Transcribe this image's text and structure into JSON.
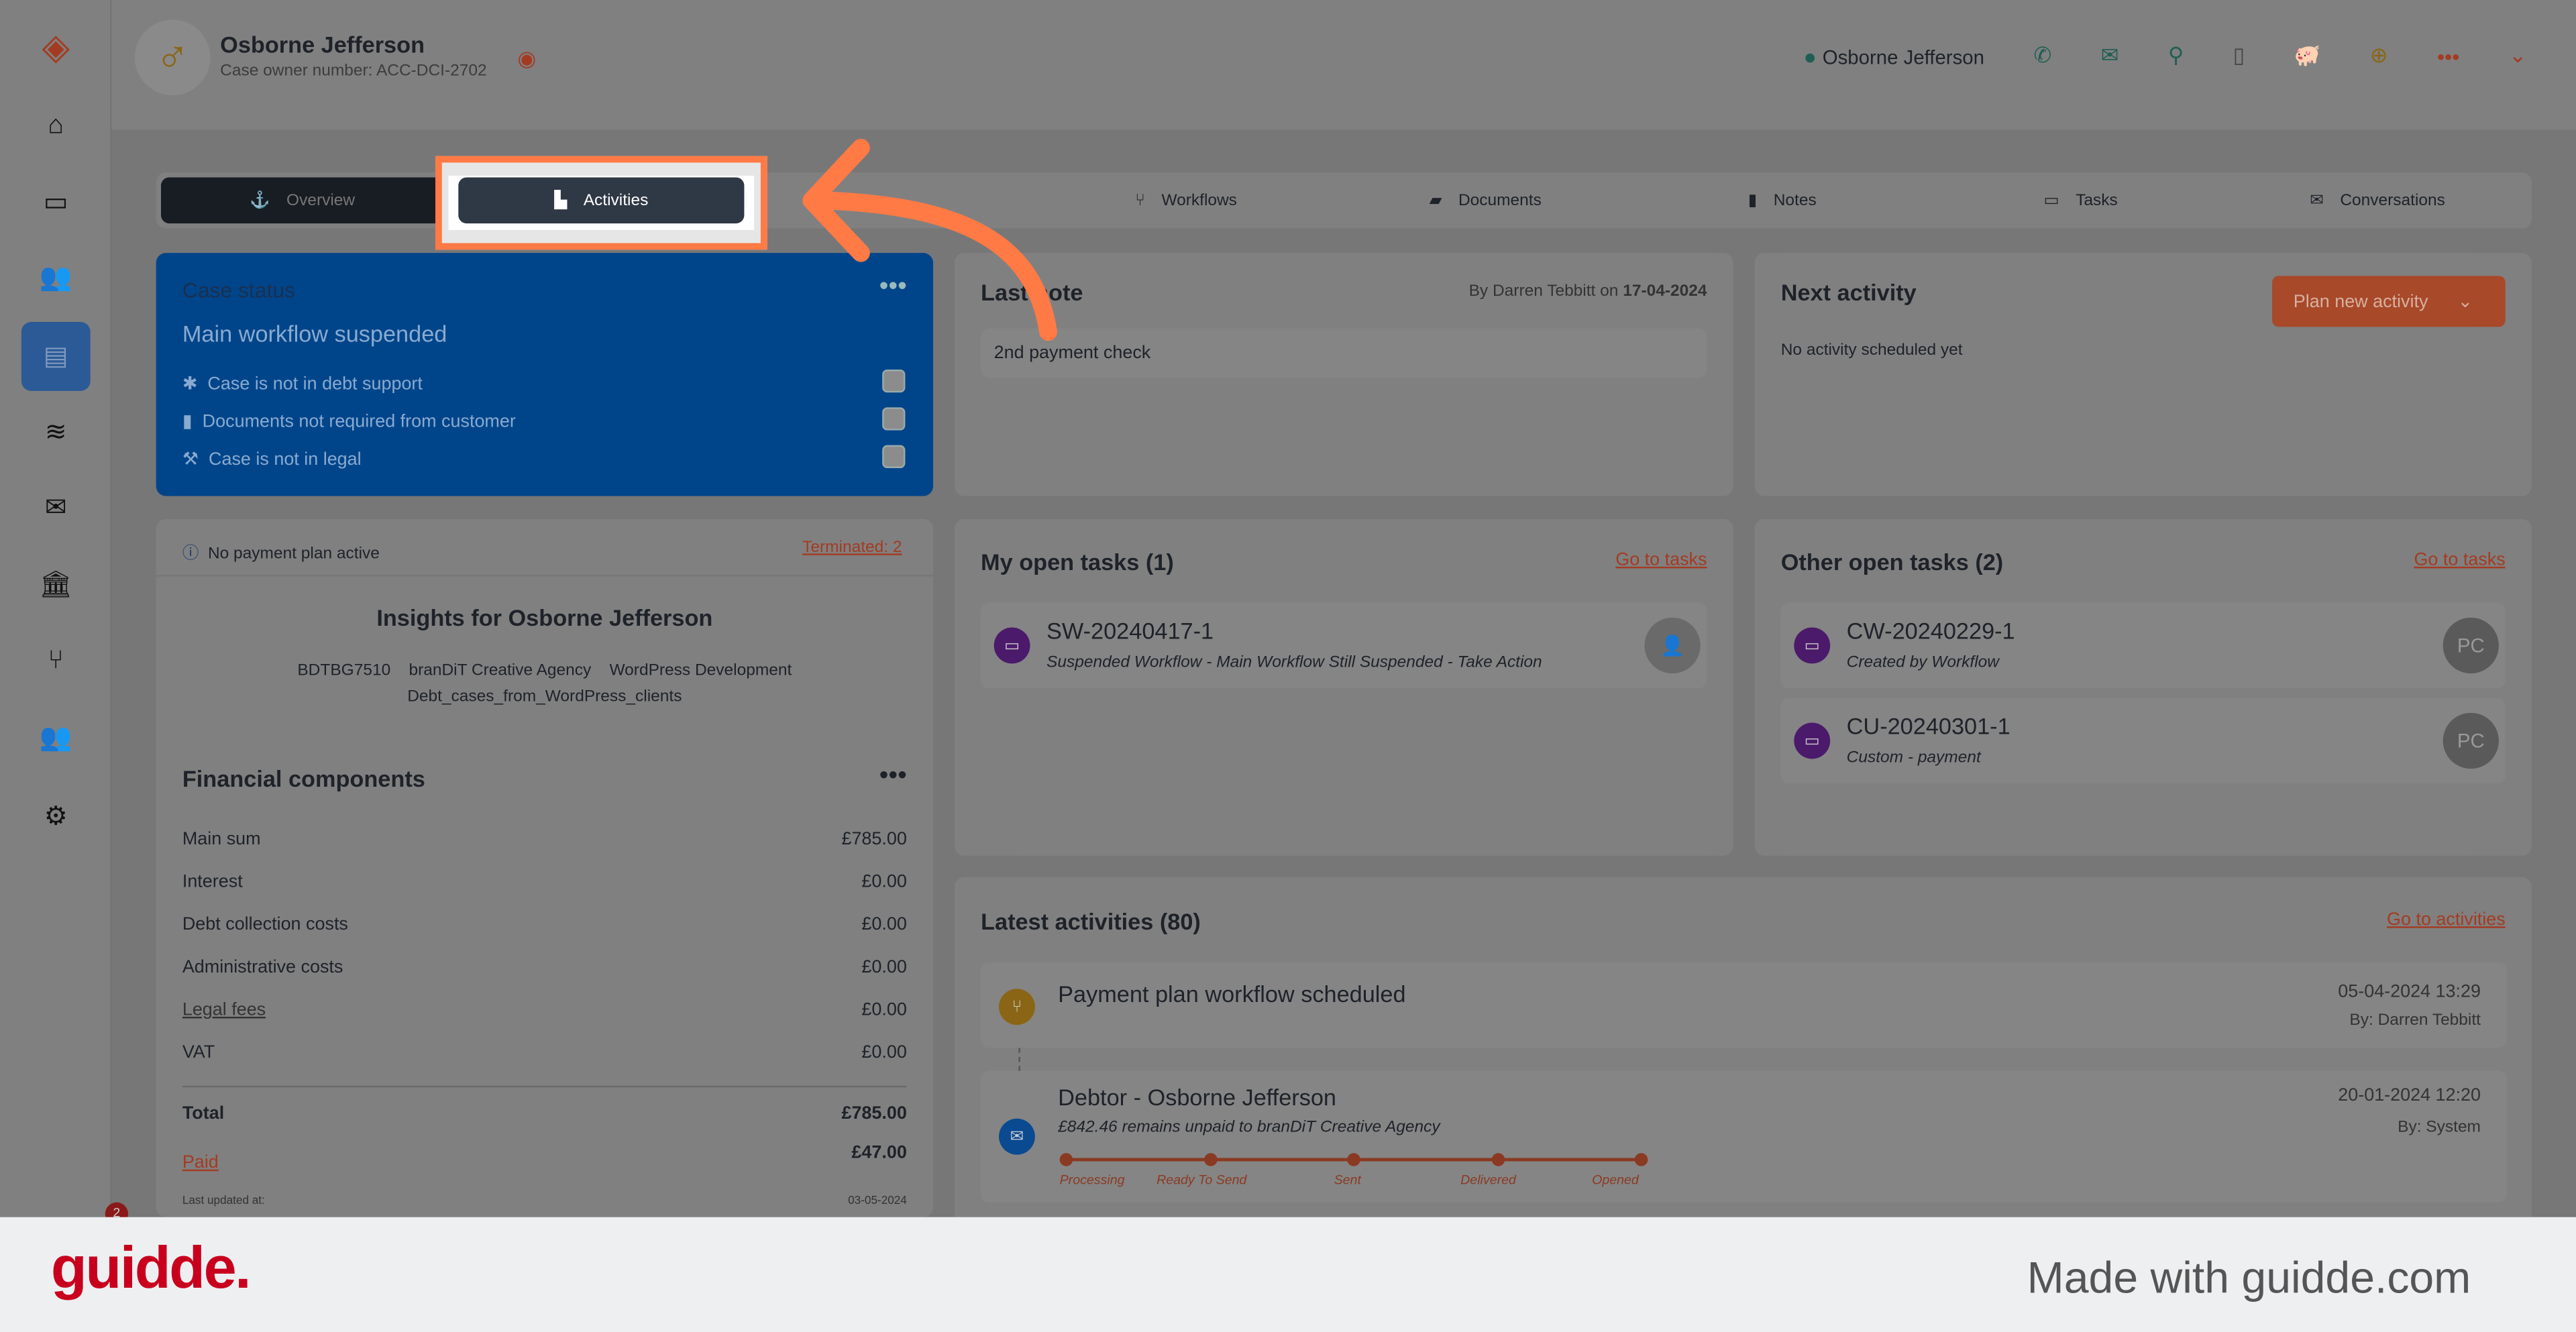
{
  "sidebar": {
    "items": [
      "logo-icon",
      "home-icon",
      "ticket-icon",
      "users-icon",
      "contact-card-icon",
      "database-icon",
      "envelope-icon",
      "bank-icon",
      "branch-icon",
      "groups-icon",
      "gear-icon"
    ],
    "notification_count": "2"
  },
  "header": {
    "name": "Osborne Jefferson",
    "case_owner": "Case owner number: ACC-DCI-2702",
    "contact_name": "Osborne Jefferson"
  },
  "tabs": [
    {
      "label": "Overview"
    },
    {
      "label": "Activities"
    },
    {
      "label": "Workflows"
    },
    {
      "label": "Documents"
    },
    {
      "label": "Notes"
    },
    {
      "label": "Tasks"
    },
    {
      "label": "Conversations"
    }
  ],
  "case_status": {
    "title": "Case status",
    "status": "Main workflow suspended",
    "items": [
      "Case is not in debt support",
      "Documents not required from customer",
      "Case is not in legal"
    ]
  },
  "last_note": {
    "title": "Last note",
    "by": "By Darren Tebbitt on",
    "date": "17-04-2024",
    "text": "2nd payment check"
  },
  "next_activity": {
    "title": "Next activity",
    "button": "Plan new activity",
    "empty": "No activity scheduled yet"
  },
  "payment_plan": {
    "text": "No payment plan active",
    "terminated": "Terminated: 2"
  },
  "insights": {
    "title": "Insights for Osborne Jefferson",
    "tags": [
      "BDTBG7510",
      "branDiT Creative Agency",
      "WordPress Development",
      "Debt_cases_from_WordPress_clients"
    ]
  },
  "financial": {
    "title": "Financial components",
    "rows": [
      {
        "label": "Main sum",
        "value": "£785.00"
      },
      {
        "label": "Interest",
        "value": "£0.00"
      },
      {
        "label": "Debt collection costs",
        "value": "£0.00"
      },
      {
        "label": "Administrative costs",
        "value": "£0.00"
      },
      {
        "label": "Legal fees",
        "value": "£0.00"
      },
      {
        "label": "VAT",
        "value": "£0.00"
      }
    ],
    "total_label": "Total",
    "total": "£785.00",
    "paid_label": "Paid",
    "paid": "£47.00",
    "updated_label": "Last updated at:",
    "updated": "03-05-2024"
  },
  "my_tasks": {
    "title": "My open tasks (1)",
    "link": "Go to tasks",
    "items": [
      {
        "id": "SW-20240417-1",
        "desc": "Suspended Workflow - Main Workflow Still Suspended - Take Action"
      }
    ]
  },
  "other_tasks": {
    "title": "Other open tasks (2)",
    "link": "Go to tasks",
    "items": [
      {
        "id": "CW-20240229-1",
        "desc": "Created by Workflow",
        "avatar": "PC"
      },
      {
        "id": "CU-20240301-1",
        "desc": "Custom - payment",
        "avatar": "PC"
      }
    ]
  },
  "activities": {
    "title": "Latest activities (80)",
    "link": "Go to activities",
    "items": [
      {
        "title": "Payment plan workflow scheduled",
        "date": "05-04-2024 13:29",
        "by": "By: Darren Tebbitt"
      },
      {
        "title": "Debtor - Osborne Jefferson",
        "subtitle": "£842.46 remains unpaid to branDiT Creative Agency",
        "date": "20-01-2024 12:20",
        "by": "By: System",
        "steps": [
          "Processing",
          "Ready To Send",
          "Sent",
          "Delivered",
          "Opened"
        ]
      }
    ]
  },
  "footer": {
    "logo": "guidde.",
    "tagline": "Made with guidde.com"
  },
  "colors": {
    "accent": "#ff7a45",
    "status_blue": "#00458a",
    "brand_red": "#c8001e"
  }
}
